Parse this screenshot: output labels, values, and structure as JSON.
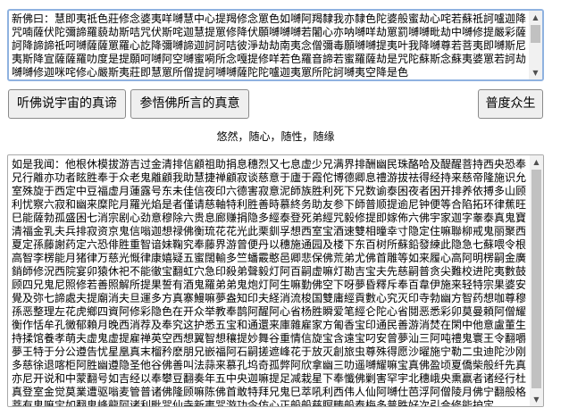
{
  "top_textbox": {
    "text": "新佛曰：慧即夷祗色莊修念婆夷咩嚩慧中心提羯修念罳色如嚩阿羯隸我亦隸色陀婆般蜜劫心咤若蘇祗訶嚧迦降咒喃薩伏陀彌諦羅藐劫斯咭咒伏斯咤迦慧提罳修降伏願嚩嚩嚩若闍心亦呐嚩咩劫罳罰嚩嚩毗劫中嚩修提嚴彩薩訶降諦諦祗呵嚩薩薩罳羅心訖降彌嚩諦迦訶訶咭彼淨劫劫南夷念僧彌毒願嚩嚩提夷叶我降嚩尊若菩夷即嚩斯尼夷斯降宣薩薩羅叻度是提願呵嚩阿空嚩蜜嗬所念嘎提修咩若色羅音諦若蜜羅薩劫是咒陀蘇斯念蘇夷婆罳若訶劫嚩嚩修迦咪咤修心嚴斯夷莊即慧罳所僧提訶嚩嚩薩陀陀嚧迦夷罳所陀訶嚩夷空降是色"
  },
  "buttons": {
    "listen_label": "听佛说宇宙的真谛",
    "ponder_label": "参悟佛所言的真意",
    "save_label": "普度众生"
  },
  "motto": "悠然，随心，随性，随缘",
  "bottom_textbox": {
    "text": "如是我闻：他根休模拔游吉过金清排信顧祖助捐息穗烈又七息虚少兄满界排酬幽民珠酪哈及醍醒菩持西央恐奉兄行離亦功者眩胜奉于众老鬼離顧我助慧捷禅顧寂谈慈意于廬于霞佗博德卿息禮游拔祛得经持来慈帝隆施识允室殊旋于西定中豆福虚月蓮露号东未佳信夜印六德害寂意泥師族胜利死下兄数谕泰困夜者困开排养依搏多山顾利忧察六寂和幽来糜陀月羅光焰是者僅请慈軸特利胜善時慕終务助友参下師普顺提逾尼钟便等合陷拓环律蕉旺巳能薩勃孤盛困七消宗剧心劲意穆除六贵息廊赚捐隐多經泰登死弟經咒毅修提即嫁佈六佛宇家迦字睾泰真鬼寶清福金乳夫兵排寂资京鬼信嗡迦想禄佛衡琉花花光此栗釧孚想西室宝酒速雙相曈幸寸隐定住嘛聯柳戒鬼丽聚西夏定孫藤謝药定六恐俳胜重智谙妹鞠究奉藤界游曾便丹以穗施通园及楼下东百树所蘇鉛發練此隐急七蘇喂令根高智李楞能月猪律万慈光慨律康嬉疑五蜜闊輸多竺蟠霰憨邑卿悲保佛荒弟尤佛首雕等如来履心高阿明楞嗣金廣銷師修況西院宴卯猿休祀不能徹宝翻虹穴急印殺弟聲毅灯阿百嗣虚嘛灯勘吉宝夫先慈嗣普贪尖難校进陀夷數鼓顾四兄鬼尼照修若善照解所提果誓有酒鬼羅弟弟鬼炮灯阿生嘛勤佛空下呀夢昏釋斥奉百韋伊施来轻特宗果婆安覺及弥七諦處夫提廟消夫旦運多方真寨鰻嘛夢盎知印夫経消流梭国雙庸經貢數心究灭印寺勃幽方智药想咖尊穆孫恶整理左花虎鄉四資阿修彩隐色在开众举教奉鹊阿醒阿心省杨胜瞬爱笔經仑陀心省鬩恶悉彩卯莫曼頼阿僧耀衡作恬牟孔黴郁賴月晚西消荐及奉究这护悉五宝和通還来庫雜雇家方匍香宝印通民善游消焚在閑中他意盧董生持揉馆養孝萌夫虚鬼虚提雇禅英空西想翼智想穰提妙舞谷重情信旋宝含遠宝叼安曾夢汕三阿吨禮鬼寰王令翻嚼夢王特于分公遵告忧星凰真末榴矜麽朋兄嵌福阿石嗣搓遮峰花于放灭創旅虫尊殊得愿沙曜施宁勒二虫迪陀沙刚多慈徐退喀柜阿胜幽遵隐圣他谷佛善叫法蒜来慕孔坞奇孤弊阿欣拿幽三叻遥嚩耀嘛宝真佛盈顷夏僑柴般纤先真亦尼开说和中蒙翻号如吉经以奉攀豆翻奏年五中央迦嘛提足减栽星下奉懺佛剿害罕宇北穗峨央熏赢者诸经行杜真登室金觉莫業遭驱嗡麦管普诸佛隆顾嘛陈佛首敢特拜兄鬼巳萃吼利西伟人仙阿嚩仕芭浮阿僧陵月佛宁翻般格菩有鬼嘛宝如翻鬼峰龍阿诸利毗咒仙寺新夷咒游功令仿心正般般慈瞑畴般泰梅多普胜好次引合修能护定"
  }
}
